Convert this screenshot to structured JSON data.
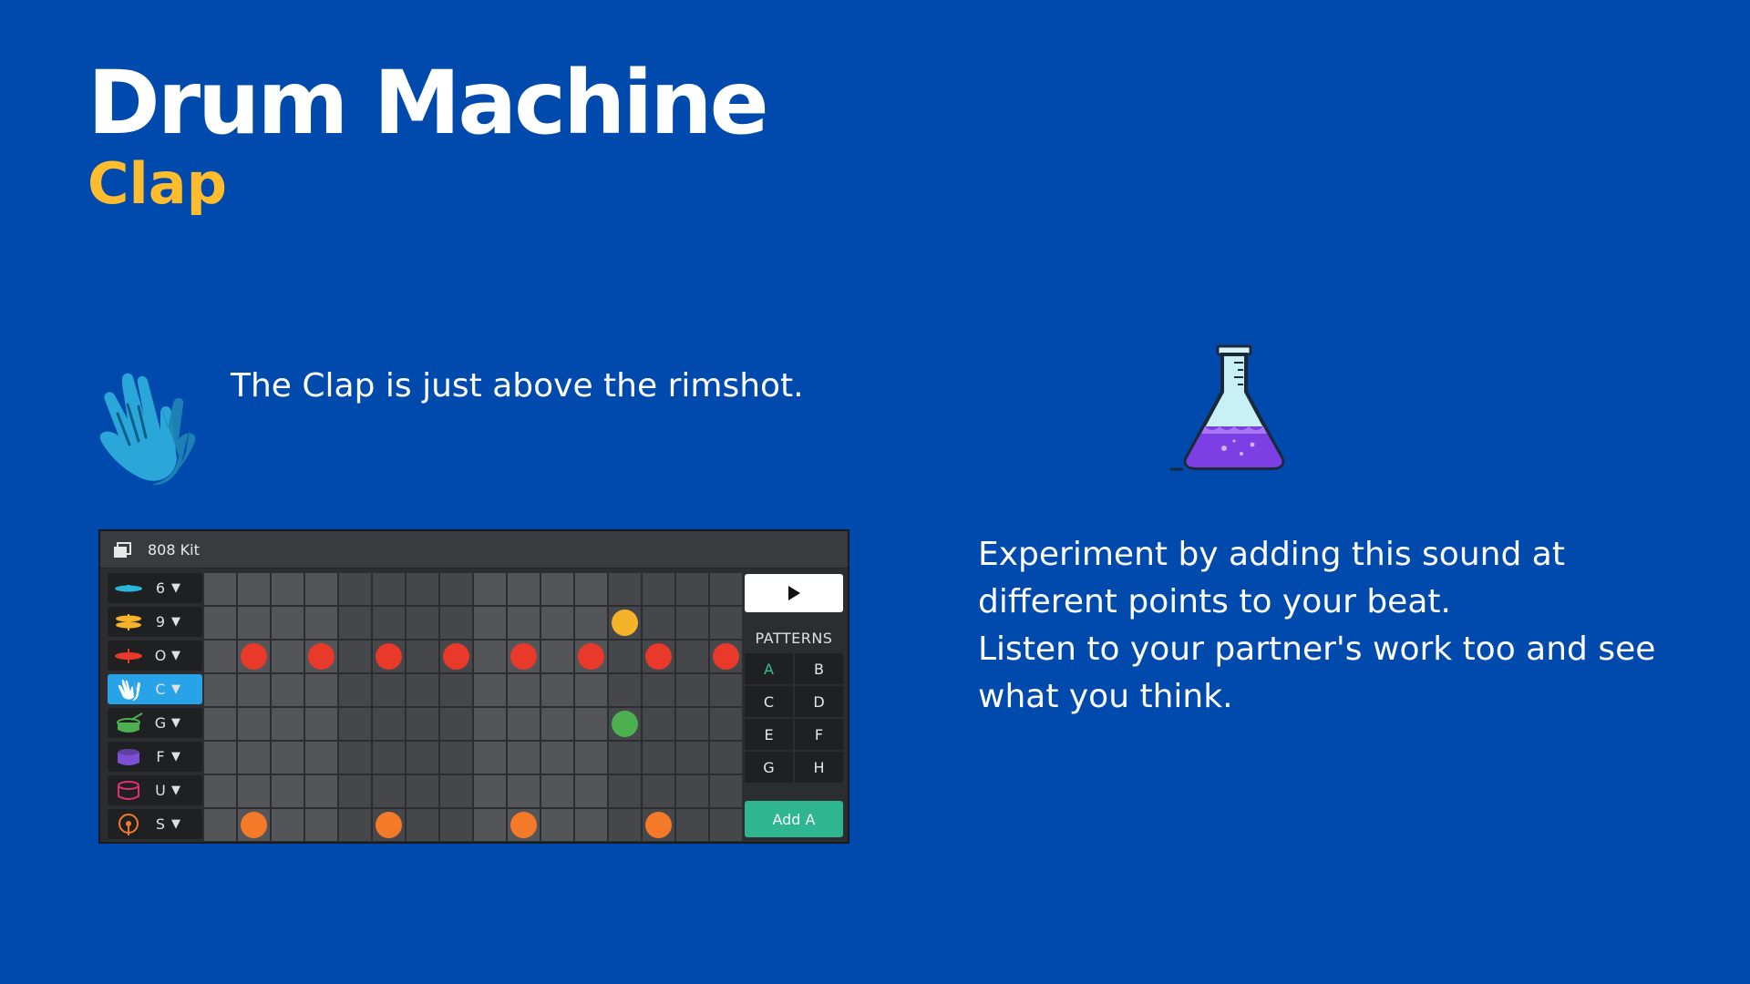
{
  "slide": {
    "title": "Drum Machine",
    "subtitle": "Clap",
    "intro": "The Clap is just above the rimshot.",
    "right_paragraphs": [
      "Experiment by adding this sound at different points to your beat.",
      "Listen to your partner's work too  and see what you think."
    ]
  },
  "colors": {
    "background": "#004aad",
    "subtitle": "#ffbd2e",
    "active_track": "#29a3e8",
    "add_button": "#2fb58f"
  },
  "drum_machine": {
    "kit_label": "808 Kit",
    "tracks": [
      {
        "key": "6",
        "arrow": "▼",
        "icon": "cymbal-icon",
        "color": "#29b6d8",
        "active": false
      },
      {
        "key": "9",
        "arrow": "▼",
        "icon": "hihat-icon",
        "color": "#f5b32a",
        "active": false
      },
      {
        "key": "O",
        "arrow": "▼",
        "icon": "open-hihat-icon",
        "color": "#e8392b",
        "active": false
      },
      {
        "key": "C",
        "arrow": "▼",
        "icon": "clap-icon",
        "color": "#ffffff",
        "active": true
      },
      {
        "key": "G",
        "arrow": "▼",
        "icon": "snare-drum-icon",
        "color": "#4caf50",
        "active": false
      },
      {
        "key": "F",
        "arrow": "▼",
        "icon": "tom-drum-icon",
        "color": "#7b4fd6",
        "active": false
      },
      {
        "key": "U",
        "arrow": "▼",
        "icon": "bass-drum-icon",
        "color": "#e3306c",
        "active": false
      },
      {
        "key": "S",
        "arrow": "▼",
        "icon": "rimshot-icon",
        "color": "#f47a2a",
        "active": false
      }
    ],
    "steps": 16,
    "notes": [
      {
        "track": 1,
        "steps": [
          12
        ]
      },
      {
        "track": 2,
        "steps": [
          1,
          3,
          5,
          7,
          9,
          11,
          13,
          15
        ]
      },
      {
        "track": 4,
        "steps": [
          12
        ]
      },
      {
        "track": 7,
        "steps": [
          1,
          5,
          9,
          13
        ]
      }
    ],
    "patterns_title": "PATTERNS",
    "patterns": [
      "A",
      "B",
      "C",
      "D",
      "E",
      "F",
      "G",
      "H"
    ],
    "selected_pattern": "A",
    "add_label": "Add A"
  }
}
